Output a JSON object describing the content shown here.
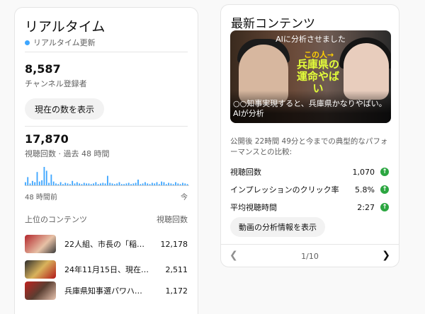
{
  "realtime": {
    "title": "リアルタイム",
    "live_label": "リアルタイム更新",
    "subscribers": {
      "value": "8,587",
      "label": "チャンネル登録者"
    },
    "show_count_button": "現在の数を表示",
    "views": {
      "value": "17,870",
      "label": "視聴回数 · 過去 48 時間"
    },
    "chart_axis": {
      "start": "48 時間前",
      "end": "今"
    },
    "top_content_header": "上位のコンテンツ",
    "views_header": "視聴回数",
    "items": [
      {
        "title": "22人組、市長の「稲村…",
        "views": "12,178"
      },
      {
        "title": "24年11月15日、現在、C…",
        "views": "2,511"
      },
      {
        "title": "兵庫県知事選パワハラ疑…",
        "views": "1,172"
      }
    ]
  },
  "latest": {
    "title": "最新コンテンツ",
    "video": {
      "overlay_caption": "AIに分析させました",
      "overlay_tag": "この人→",
      "overlay_yellow": "兵庫県の運命やばい",
      "title": "○○知事実現すると、兵庫県かなりやばい。AIが分析"
    },
    "performance_text": "公開後 22時間 49分と今までの典型的なパフォーマンスとの比較:",
    "metrics": [
      {
        "label": "視聴回数",
        "value": "1,070"
      },
      {
        "label": "インプレッションのクリック率",
        "value": "5.8%"
      },
      {
        "label": "平均視聴時間",
        "value": "2:27"
      }
    ],
    "analytics_button": "動画の分析情報を表示",
    "pager": "1/10"
  },
  "colors": {
    "bar": "#3ea6ff",
    "up": "#2ba640"
  },
  "chart_data": {
    "type": "bar",
    "values": [
      6,
      14,
      4,
      8,
      6,
      22,
      7,
      9,
      30,
      24,
      5,
      18,
      7,
      4,
      3,
      6,
      3,
      5,
      4,
      3,
      8,
      4,
      6,
      4,
      3,
      5,
      4,
      4,
      3,
      4,
      6,
      3,
      4,
      5,
      4,
      16,
      5,
      4,
      3,
      4,
      6,
      3,
      3,
      4,
      5,
      3,
      4,
      5,
      10,
      3,
      4,
      6,
      4,
      3,
      5,
      4,
      6,
      3,
      7,
      6,
      3,
      5,
      4,
      3,
      6,
      4,
      3,
      5,
      4,
      3
    ],
    "xlabel": "",
    "ylabel": ""
  }
}
